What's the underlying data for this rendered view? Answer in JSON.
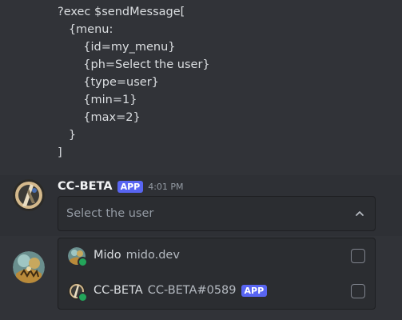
{
  "code_message": {
    "lines": [
      "?exec $sendMessage[",
      "   {menu:",
      "       {id=my_menu}",
      "       {ph=Select the user}",
      "       {type=user}",
      "       {min=1}",
      "       {max=2}",
      "   }",
      "]"
    ]
  },
  "bot_message": {
    "author": "CC-BETA",
    "badge": "APP",
    "timestamp": "4:01 PM",
    "select": {
      "placeholder": "Select the user",
      "icon": "chevron-up-icon"
    }
  },
  "dropdown": {
    "options": [
      {
        "name": "Mido",
        "subtext": "mido.dev",
        "badge": "",
        "status_color": "#23a55a"
      },
      {
        "name": "CC-BETA",
        "subtext": "CC-BETA#0589",
        "badge": "APP",
        "status_color": "#23a55a"
      }
    ]
  },
  "colors": {
    "background": "#313338",
    "accent": "#5865f2",
    "online": "#23a55a"
  }
}
